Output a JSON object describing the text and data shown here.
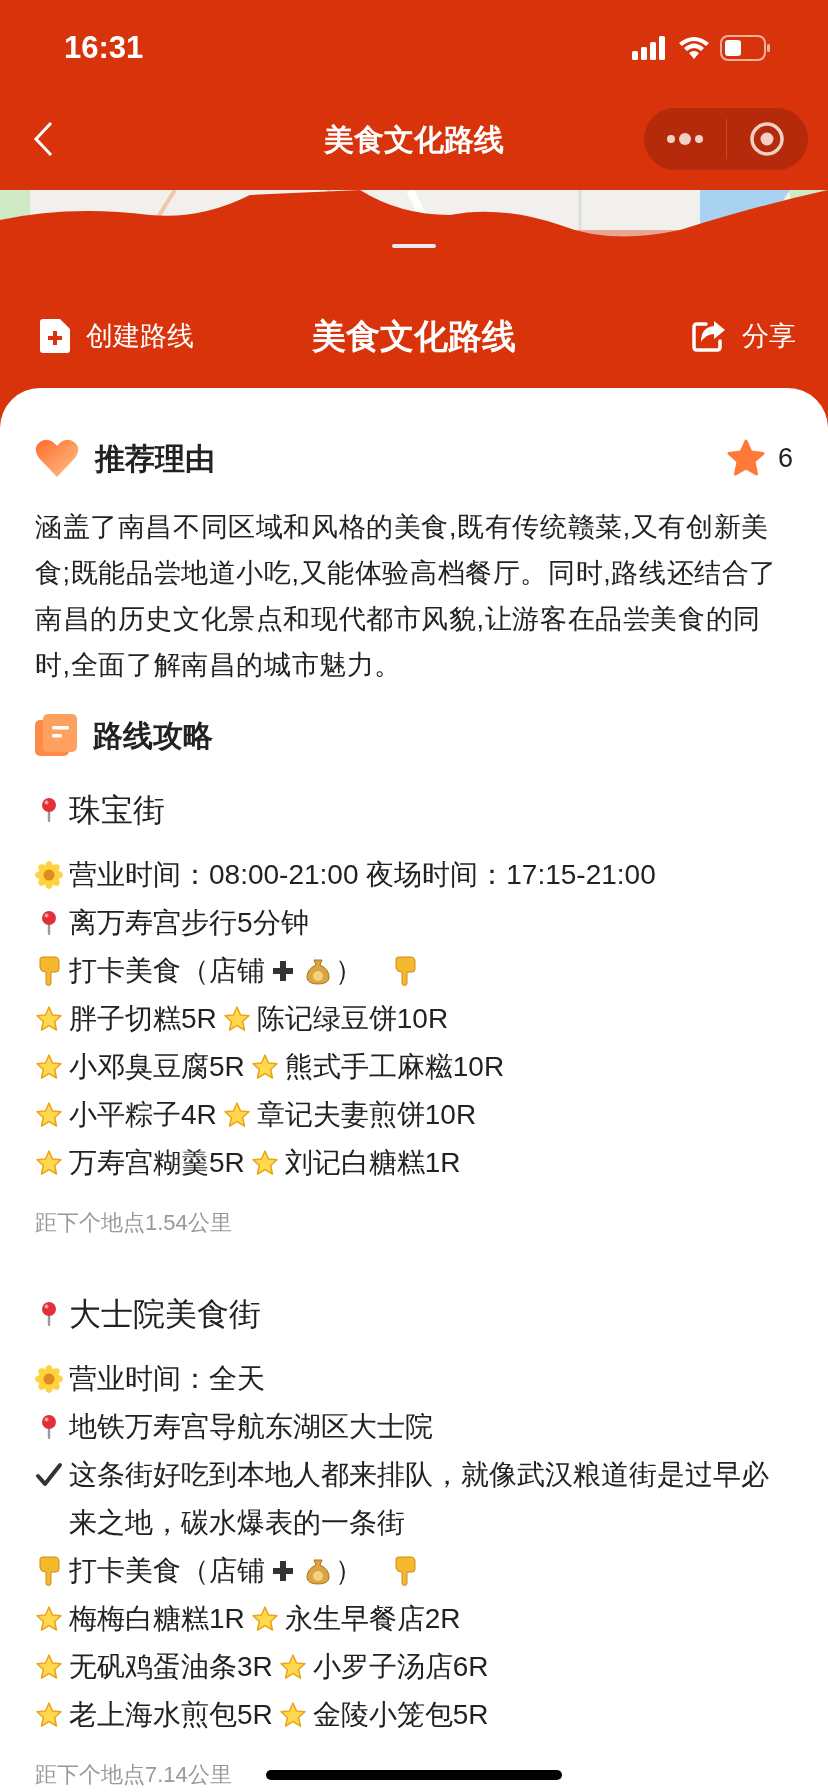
{
  "status_bar": {
    "time": "16:31"
  },
  "nav_bar": {
    "title": "美食文化路线"
  },
  "header": {
    "create_label": "创建路线",
    "title": "美食文化路线",
    "share_label": "分享"
  },
  "recommendation": {
    "title": "推荐理由",
    "rating": "6",
    "text": "涵盖了南昌不同区域和风格的美食,既有传统赣菜,又有创新美食;既能品尝地道小吃,又能体验高档餐厅。同时,路线还结合了南昌的历史文化景点和现代都市风貌,让游客在品尝美食的同时,全面了解南昌的城市魅力。"
  },
  "guide": {
    "title": "路线攻略",
    "stops": [
      {
        "name": "珠宝街",
        "lines": [
          {
            "kind": "hours",
            "text": "营业时间：08:00-21:00 夜场时间：17:15-21:00"
          },
          {
            "kind": "location",
            "text": "离万寿宫步行5分钟"
          },
          {
            "kind": "food_header",
            "before": "打卡美食（店铺",
            "after": "）"
          },
          {
            "kind": "dishes",
            "items": [
              "胖子切糕5R",
              "陈记绿豆饼10R"
            ]
          },
          {
            "kind": "dishes",
            "items": [
              "小邓臭豆腐5R",
              "熊式手工麻糍10R"
            ]
          },
          {
            "kind": "dishes",
            "items": [
              "小平粽子4R",
              "章记夫妻煎饼10R"
            ]
          },
          {
            "kind": "dishes",
            "items": [
              "万寿宫糊羹5R",
              "刘记白糖糕1R"
            ]
          }
        ],
        "distance": "距下个地点1.54公里"
      },
      {
        "name": "大士院美食街",
        "lines": [
          {
            "kind": "hours",
            "text": "营业时间：全天"
          },
          {
            "kind": "location",
            "text": "地铁万寿宫导航东湖区大士院"
          },
          {
            "kind": "note",
            "text": "这条街好吃到本地人都来排队，就像武汉粮道街是过早必来之地，碳水爆表的一条街"
          },
          {
            "kind": "food_header",
            "before": "打卡美食（店铺",
            "after": "）"
          },
          {
            "kind": "dishes",
            "items": [
              "梅梅白糖糕1R",
              "永生早餐店2R"
            ]
          },
          {
            "kind": "dishes",
            "items": [
              "无矾鸡蛋油条3R",
              "小罗子汤店6R"
            ]
          },
          {
            "kind": "dishes",
            "items": [
              "老上海水煎包5R",
              "金陵小笼包5R"
            ]
          }
        ],
        "distance": "距下个地点7.14公里"
      }
    ]
  }
}
